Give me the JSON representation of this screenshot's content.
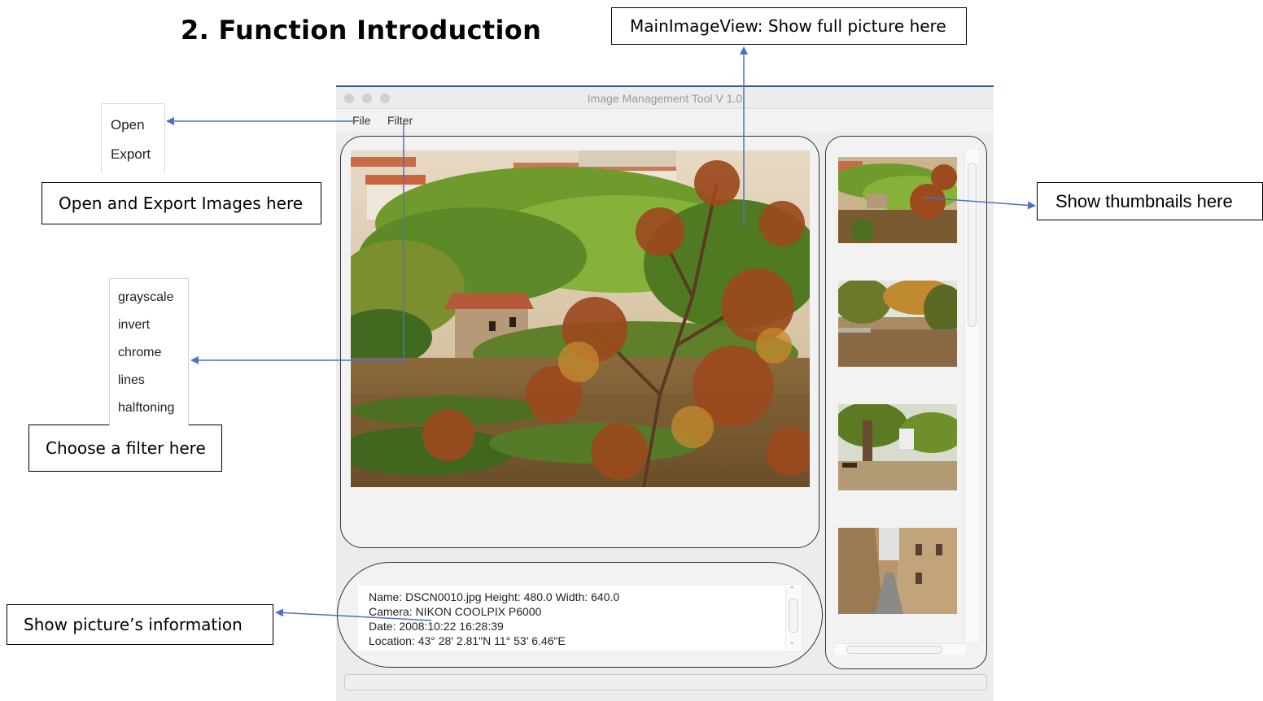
{
  "heading": "2.  Function Introduction",
  "callouts": {
    "main_view": "MainImageView: Show full picture here",
    "open_export": "Open and Export Images here",
    "thumbnails": "Show thumbnails here",
    "filter": "Choose a filter here",
    "info": "Show picture’s information"
  },
  "file_menu": {
    "items": [
      "Open",
      "Export"
    ]
  },
  "filter_menu": {
    "items": [
      "grayscale",
      "invert",
      "chrome",
      "lines",
      "halftoning"
    ]
  },
  "window": {
    "title": "Image Management Tool V 1.0",
    "menu": {
      "file": "File",
      "filter": "Filter"
    }
  },
  "info": {
    "line1": "Name: DSCN0010.jpg Height: 480.0  Width: 640.0",
    "line2": "Camera: NIKON COOLPIX P6000",
    "line3": "Date: 2008:10:22 16:28:39",
    "line4": "Location: 43° 28' 2.81\"N  11° 53' 6.46\"E"
  },
  "thumbnails": [
    "landscape-hillside",
    "autumn-path",
    "park-tree",
    "narrow-street"
  ],
  "colors": {
    "arrow": "#4a72c4",
    "panel_border": "#333333",
    "window_bg": "#ececec"
  }
}
